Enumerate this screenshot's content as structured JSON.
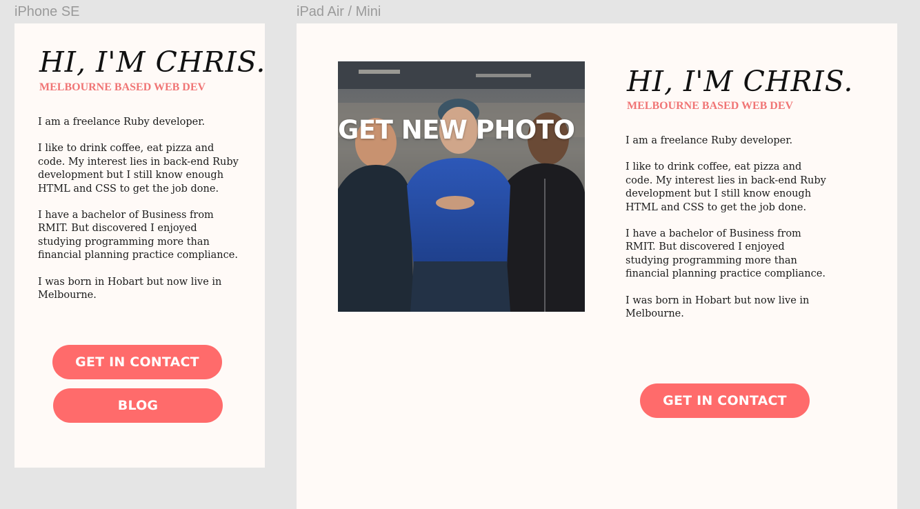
{
  "frames": {
    "phone_label": "iPhone SE",
    "tablet_label": "iPad Air / Mini"
  },
  "profile": {
    "headline": "HI, I'M CHRIS.",
    "subheading": "MELBOURNE BASED WEB DEV",
    "bio": [
      "I am a freelance Ruby developer.",
      "I like to drink coffee, eat pizza and code.  My interest lies in back-end Ruby development but I still know enough HTML and CSS to get the job done.",
      "I have a bachelor of Business from RMIT.  But discovered I enjoyed studying programming more than financial planning practice compliance.",
      "I was born in Hobart but now live in Melbourne."
    ]
  },
  "actions": {
    "contact_label": "GET IN CONTACT",
    "blog_label": "BLOG",
    "photo_label": "GET NEW PHOTO"
  },
  "colors": {
    "accent": "#ff6b6b",
    "subheading": "#f07575",
    "artboard": "#fffaf7",
    "canvas": "#e5e5e5"
  }
}
